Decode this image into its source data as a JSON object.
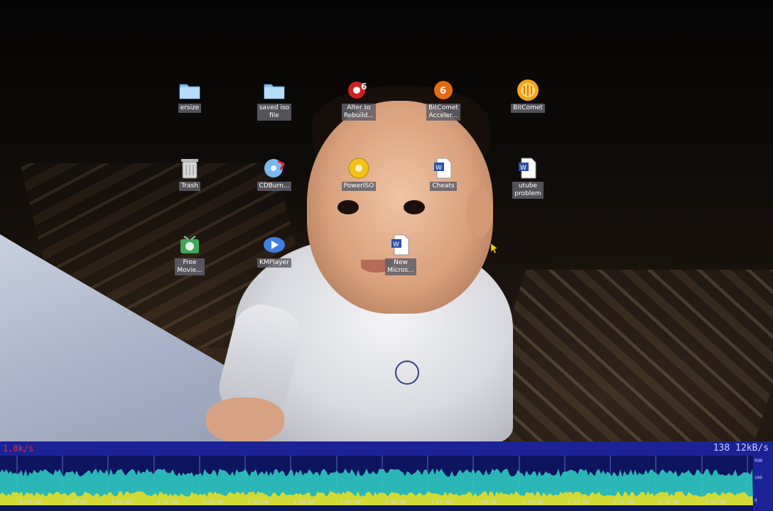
{
  "desktop": {
    "icons": [
      {
        "id": "ersize",
        "label": "ersize",
        "icon": "folder-icon"
      },
      {
        "id": "saved-iso",
        "label": "saved iso\nfile",
        "icon": "folder-icon"
      },
      {
        "id": "alter-rebuild",
        "label": "Alter to\nRebuild...",
        "icon": "disc-app-icon"
      },
      {
        "id": "bitcomet-acc",
        "label": "BitComet\nAcceler...",
        "icon": "orange-circle-icon"
      },
      {
        "id": "bitcomet",
        "label": "BitComet",
        "icon": "bitcomet-icon"
      },
      {
        "id": "trash",
        "label": "Trash",
        "icon": "trash-icon"
      },
      {
        "id": "cdburn",
        "label": "CDBurn...",
        "icon": "cd-burn-icon"
      },
      {
        "id": "poweriso",
        "label": "PowerISO",
        "icon": "poweriso-icon"
      },
      {
        "id": "cheats",
        "label": "Cheats",
        "icon": "word-doc-icon"
      },
      {
        "id": "utube",
        "label": "utube\nproblem",
        "icon": "word-doc-icon"
      },
      {
        "id": "free-movie",
        "label": "Free\nMovie...",
        "icon": "movie-app-icon"
      },
      {
        "id": "kmplayer",
        "label": "KMPlayer",
        "icon": "kmplayer-icon"
      },
      {
        "id": "new-microsoft",
        "label": "New\nMicros...",
        "icon": "word-doc-icon"
      }
    ]
  },
  "netmon": {
    "left_text": "1.8k/s",
    "right_text": "138 12kB/s",
    "time_labels": [
      "0:58:00",
      "0:59:00",
      "1:00:00",
      "1:01:00",
      "1:02:00",
      "1:03:00",
      "1:04:00",
      "1:05:00",
      "1:06:00",
      "1:07:00",
      "1:08:00",
      "1:09:00",
      "1:10:00",
      "1:11:00",
      "1:12:00",
      "1:13:00"
    ],
    "side_labels": [
      "RUN",
      "100",
      "0"
    ],
    "colors": {
      "download": "#2fc9c0",
      "upload": "#f0e020",
      "background": "#0e1560",
      "header": "#1a2296"
    }
  }
}
